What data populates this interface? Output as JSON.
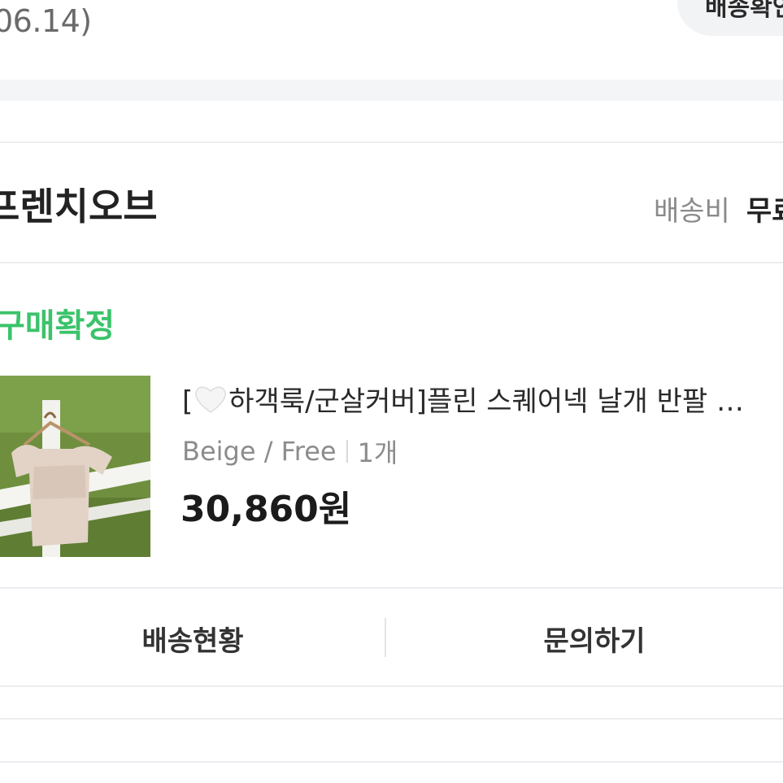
{
  "header": {
    "date_text": "06.14)",
    "pill_label": "배송확인"
  },
  "seller": {
    "name": "프렌치오브",
    "shipping_label": "배송비",
    "shipping_value": "무료"
  },
  "order": {
    "status": "구매확정",
    "status_color": "#3cc36b",
    "product": {
      "title_prefix": "[",
      "title_text": "하객룩/군살커버]플린 스퀘어넥 날개 반팔 …",
      "option": "Beige / Free",
      "quantity": "1개",
      "price": "30,860원"
    }
  },
  "actions": {
    "delivery_status": "배송현황",
    "inquiry": "문의하기"
  },
  "icons": {
    "heart": "white-heart-icon"
  }
}
